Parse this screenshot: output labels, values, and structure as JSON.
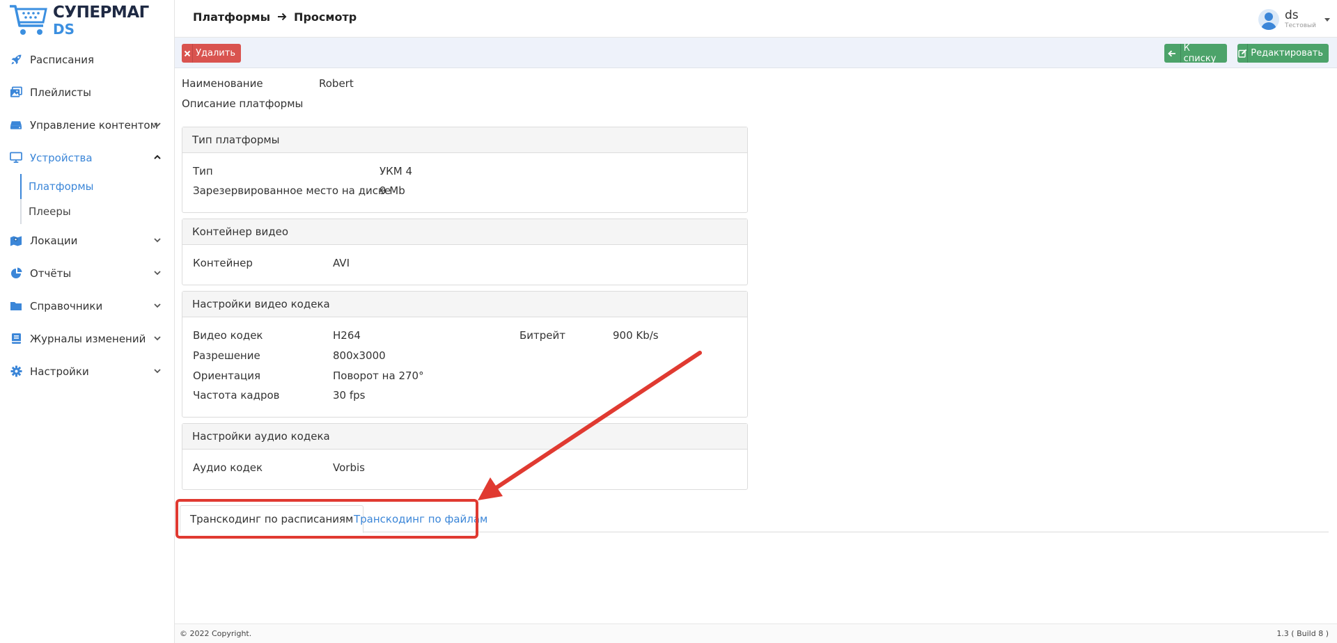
{
  "logo": {
    "line1": "СУПЕРМАГ",
    "line2": "DS"
  },
  "header": {
    "crumb1": "Платформы",
    "crumb2": "Просмотр",
    "user_name": "ds",
    "user_role": "Тестовый"
  },
  "sidebar": {
    "items": [
      {
        "label": "Расписания",
        "icon": "rocket-icon"
      },
      {
        "label": "Плейлисты",
        "icon": "images-icon"
      },
      {
        "label": "Управление контентом",
        "icon": "drive-icon"
      },
      {
        "label": "Устройства",
        "icon": "monitor-icon"
      },
      {
        "label": "Локации",
        "icon": "map-icon"
      },
      {
        "label": "Отчёты",
        "icon": "pie-chart-icon"
      },
      {
        "label": "Справочники",
        "icon": "folder-icon"
      },
      {
        "label": "Журналы изменений",
        "icon": "book-icon"
      },
      {
        "label": "Настройки",
        "icon": "gear-icon"
      }
    ],
    "sub_items": [
      {
        "label": "Платформы"
      },
      {
        "label": "Плееры"
      }
    ]
  },
  "toolbar": {
    "delete_label": "Удалить",
    "back_label": "К списку",
    "edit_label": "Редактировать"
  },
  "fields": {
    "name_label": "Наименование",
    "name_value": "Robert",
    "desc_label": "Описание платформы"
  },
  "panels": {
    "platform_type": {
      "title": "Тип платформы",
      "type_label": "Тип",
      "type_value": "УКМ 4",
      "disk_label": "Зарезервированное место на диске",
      "disk_value": "9 Mb"
    },
    "video_container": {
      "title": "Контейнер видео",
      "container_label": "Контейнер",
      "container_value": "AVI"
    },
    "video_codec": {
      "title": "Настройки видео кодека",
      "codec_label": "Видео кодек",
      "codec_value": "H264",
      "bitrate_label": "Битрейт",
      "bitrate_value": "900 Kb/s",
      "resolution_label": "Разрешение",
      "resolution_value": "800x3000",
      "orientation_label": "Ориентация",
      "orientation_value": "Поворот на 270°",
      "fps_label": "Частота кадров",
      "fps_value": "30 fps"
    },
    "audio_codec": {
      "title": "Настройки аудио кодека",
      "codec_label": "Аудио кодек",
      "codec_value": "Vorbis"
    }
  },
  "tabs": {
    "schedule": "Транскодинг по расписаниям",
    "files": "Транскодинг по файлам"
  },
  "footer": {
    "copyright": "© 2022 Copyright.",
    "version": "1.3 ( Build 8 )"
  },
  "colors": {
    "accent": "#3b86d8",
    "danger": "#d9534f",
    "success": "#4ca36a",
    "annotation": "#e03a31"
  }
}
